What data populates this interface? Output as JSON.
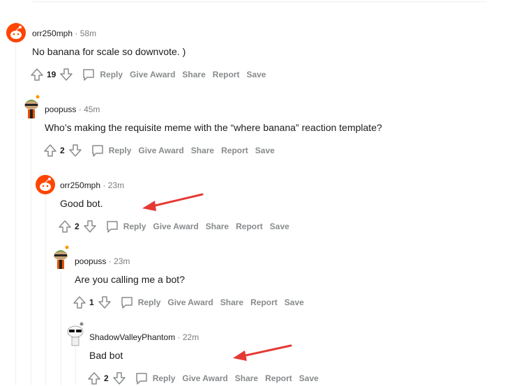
{
  "comments": [
    {
      "author": "orr250mph",
      "time": "58m",
      "body": "No banana for scale so downvote. )",
      "score": "19",
      "avatar": "reddit-snoo-orange"
    },
    {
      "author": "poopuss",
      "time": "45m",
      "body": "Who’s making the requisite meme with the “where banana” reaction template?",
      "score": "2",
      "avatar": "snoo-green-hat"
    },
    {
      "author": "orr250mph",
      "time": "23m",
      "body": "Good bot.",
      "score": "2",
      "avatar": "reddit-snoo-orange"
    },
    {
      "author": "poopuss",
      "time": "23m",
      "body": "Are you calling me a bot?",
      "score": "1",
      "avatar": "snoo-green-hat"
    },
    {
      "author": "ShadowValleyPhantom",
      "time": "22m",
      "body": "Bad bot",
      "score": "2",
      "avatar": "snoo-sunglasses"
    }
  ],
  "actions": {
    "reply": "Reply",
    "give_award": "Give Award",
    "share": "Share",
    "report": "Report",
    "save": "Save"
  },
  "separator": "·",
  "colors": {
    "accent_orange": "#ff4500",
    "annotation_arrow": "#e53935",
    "action_grey": "#878a8c"
  },
  "icons": [
    "upvote-icon",
    "downvote-icon",
    "comment-bubble-icon",
    "annotation-arrow"
  ]
}
